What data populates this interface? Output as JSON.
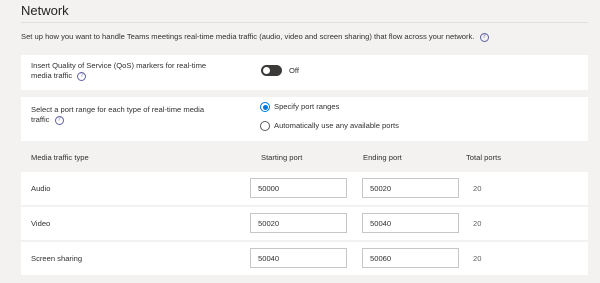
{
  "page": {
    "title": "Network",
    "description": "Set up how you want to handle Teams meetings real-time media traffic (audio, video and screen sharing) that flow across your network."
  },
  "qos": {
    "label_line1": "Insert Quality of Service (QoS) markers for real-time",
    "label_line2": "media traffic",
    "toggle_state": "Off"
  },
  "port_range": {
    "label_line1": "Select a port range for each type of real-time media",
    "label_line2": "traffic",
    "options": [
      "Specify port ranges",
      "Automatically use any available ports"
    ],
    "selected_index": 0
  },
  "table": {
    "headers": [
      "Media traffic type",
      "Starting port",
      "Ending port",
      "Total ports"
    ],
    "rows": [
      {
        "type": "Audio",
        "start": "50000",
        "end": "50020",
        "total": "20"
      },
      {
        "type": "Video",
        "start": "50020",
        "end": "50040",
        "total": "20"
      },
      {
        "type": "Screen sharing",
        "start": "50040",
        "end": "50060",
        "total": "20"
      }
    ]
  },
  "colors": {
    "accent": "#0078d4",
    "info_icon": "#6264a7",
    "toggle_off": "#3b3a39",
    "background": "#f3f2f1"
  }
}
